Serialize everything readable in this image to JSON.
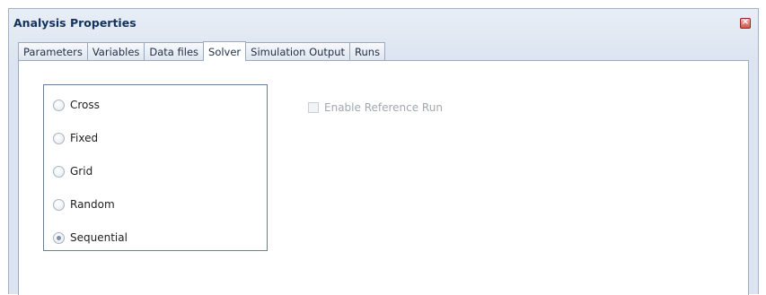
{
  "window": {
    "title": "Analysis Properties",
    "close_icon": "close-icon"
  },
  "tabs": [
    {
      "label": "Parameters",
      "active": false
    },
    {
      "label": "Variables",
      "active": false
    },
    {
      "label": "Data files",
      "active": false
    },
    {
      "label": "Solver",
      "active": true
    },
    {
      "label": "Simulation Output",
      "active": false
    },
    {
      "label": "Runs",
      "active": false
    }
  ],
  "solver": {
    "options": [
      {
        "label": "Cross",
        "checked": false
      },
      {
        "label": "Fixed",
        "checked": false
      },
      {
        "label": "Grid",
        "checked": false
      },
      {
        "label": "Random",
        "checked": false
      },
      {
        "label": "Sequential",
        "checked": true
      }
    ],
    "enable_reference_run": {
      "label": "Enable Reference Run",
      "checked": false,
      "enabled": false
    }
  },
  "colors": {
    "title_text": "#15325b",
    "tab_border": "#9aaac0",
    "disabled_text": "#a3a7ad"
  }
}
